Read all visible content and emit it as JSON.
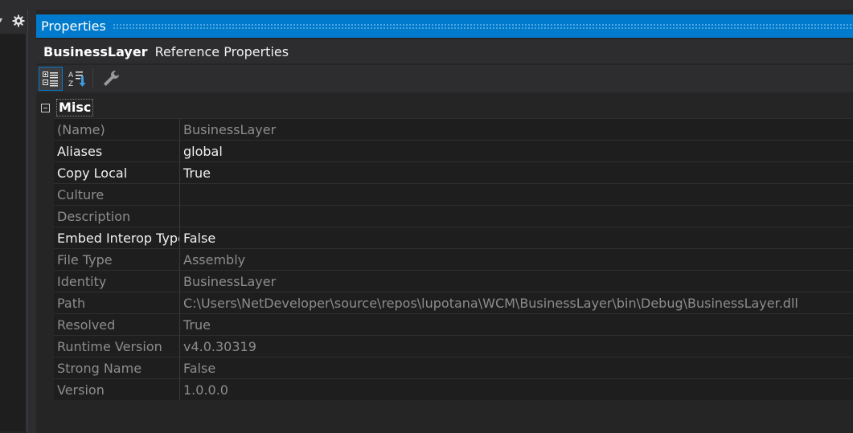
{
  "panel_title": "Properties",
  "object": {
    "name": "BusinessLayer",
    "type": "Reference Properties"
  },
  "toolbar": {
    "buttons": [
      {
        "name": "categorized",
        "icon": "categorized-icon",
        "active": true
      },
      {
        "name": "alphabetical",
        "icon": "alphabetical-icon",
        "active": false
      },
      {
        "name": "property-pages",
        "icon": "wrench-icon",
        "active": false
      }
    ]
  },
  "category": {
    "label": "Misc"
  },
  "properties": [
    {
      "name": "(Name)",
      "value": "BusinessLayer",
      "readonly": true
    },
    {
      "name": "Aliases",
      "value": "global",
      "readonly": false
    },
    {
      "name": "Copy Local",
      "value": "True",
      "readonly": false
    },
    {
      "name": "Culture",
      "value": "",
      "readonly": true
    },
    {
      "name": "Description",
      "value": "",
      "readonly": true
    },
    {
      "name": "Embed Interop Types",
      "value": "False",
      "readonly": false
    },
    {
      "name": "File Type",
      "value": "Assembly",
      "readonly": true
    },
    {
      "name": "Identity",
      "value": "BusinessLayer",
      "readonly": true
    },
    {
      "name": "Path",
      "value": "C:\\Users\\NetDeveloper\\source\\repos\\lupotana\\WCM\\BusinessLayer\\bin\\Debug\\BusinessLayer.dll",
      "readonly": true
    },
    {
      "name": "Resolved",
      "value": "True",
      "readonly": true
    },
    {
      "name": "Runtime Version",
      "value": "v4.0.30319",
      "readonly": true
    },
    {
      "name": "Strong Name",
      "value": "False",
      "readonly": true
    },
    {
      "name": "Version",
      "value": "1.0.0.0",
      "readonly": true
    }
  ],
  "colors": {
    "accent": "#007acc",
    "background": "#252526",
    "grid": "#1e1e1e",
    "readonly_text": "#8d8d8d",
    "text": "#f1f1f1"
  }
}
